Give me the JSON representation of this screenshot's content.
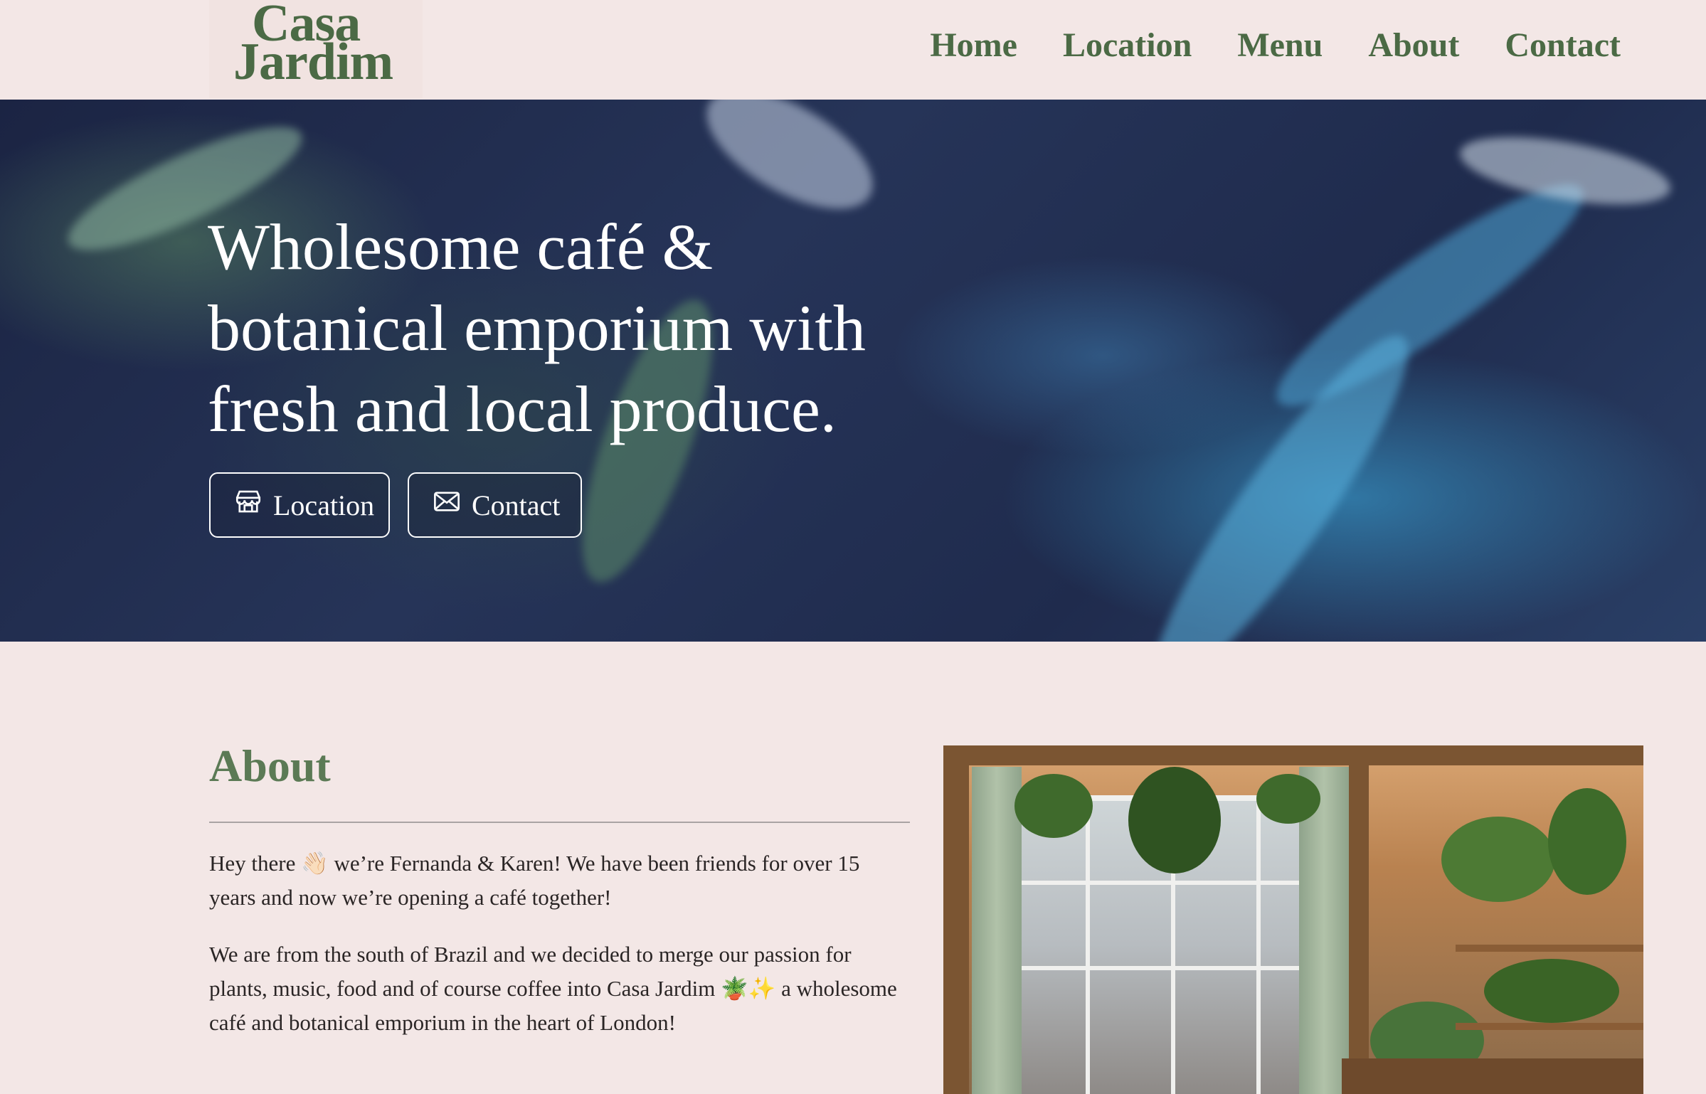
{
  "header": {
    "logo_line1": "Casa",
    "logo_line2": "Jardim",
    "nav": [
      {
        "label": "Home"
      },
      {
        "label": "Location"
      },
      {
        "label": "Menu"
      },
      {
        "label": "About"
      },
      {
        "label": "Contact"
      }
    ]
  },
  "hero": {
    "title": "Wholesome café & botanical emporium with fresh and local produce.",
    "buttons": {
      "location": {
        "label": "Location",
        "icon": "storefront-icon"
      },
      "contact": {
        "label": "Contact",
        "icon": "envelope-icon"
      }
    }
  },
  "about": {
    "title": "About",
    "p1": "Hey there 👋🏻 we’re Fernanda & Karen! We have been friends for over 15 years and now we’re opening a café together!",
    "p2": "We are from the south of Brazil and we decided to merge our passion for plants, music, food and of course coffee into Casa Jardim 🪴✨ a wholesome café and botanical emporium in the heart of London!"
  },
  "colors": {
    "background": "#f3e7e6",
    "brand_green": "#4b6a45",
    "about_heading": "#5b7a55"
  }
}
